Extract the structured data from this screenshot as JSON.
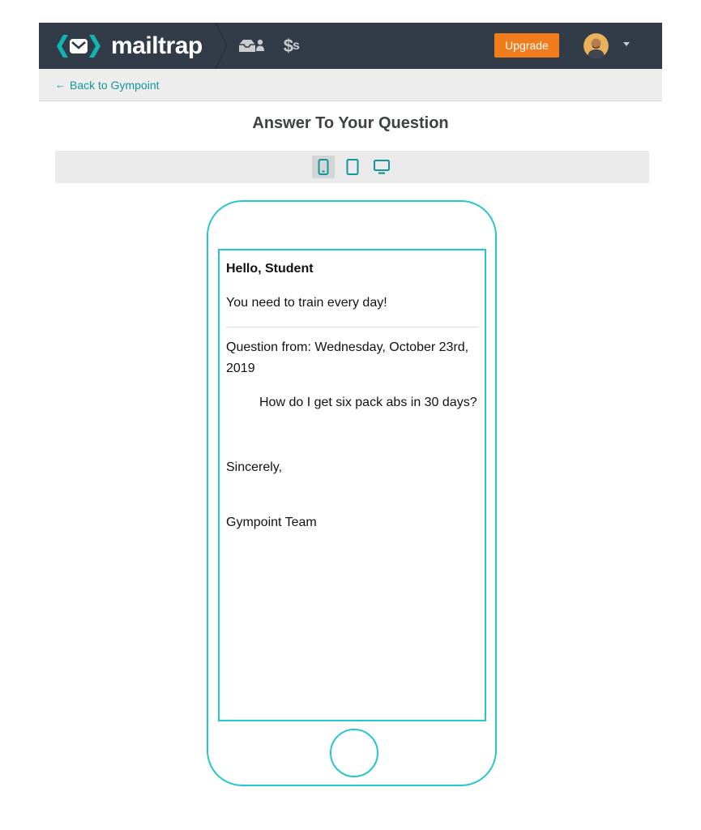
{
  "header": {
    "logo_text": "mailtrap",
    "upgrade_label": "Upgrade",
    "icons": [
      "logo-envelope-icon",
      "inboxes-icon",
      "billing-icon",
      "avatar",
      "caret-down-icon"
    ],
    "colors": {
      "navbar": "#323b48",
      "accent": "#12979a",
      "upgrade": "#f17c1b",
      "phone_frame": "#26c6cf"
    }
  },
  "nav": {
    "back_arrow": "←",
    "back_label": "Back to Gympoint",
    "billing_symbol": "$",
    "billing_symbol_small": "s"
  },
  "page": {
    "title": "Answer To Your Question"
  },
  "device_toggle": {
    "options": [
      "mobile-icon",
      "tablet-icon",
      "desktop-icon"
    ],
    "selected": "mobile-icon"
  },
  "email": {
    "greeting": "Hello, Student",
    "message": "You need to train every day!",
    "question_from": "Question from: Wednesday, October 23rd, 2019",
    "question_body": "How do I get six pack abs in 30 days?",
    "closing": "Sincerely,",
    "signature": "Gympoint Team"
  }
}
